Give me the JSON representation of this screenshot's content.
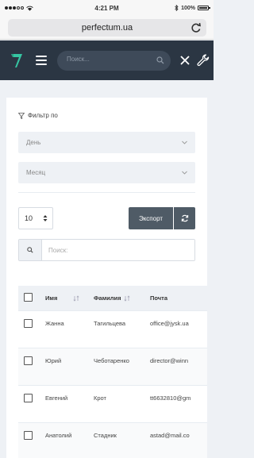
{
  "status_bar": {
    "time": "4:21 PM",
    "battery": "100%"
  },
  "browser": {
    "url": "perfectum.ua"
  },
  "header": {
    "search_placeholder": "Поиск..."
  },
  "filter": {
    "title": "Фильтр по",
    "day_select": "День",
    "month_select": "Месяц"
  },
  "toolbar": {
    "page_size": "10",
    "export_label": "Экспорт",
    "search_placeholder": "Поиск:"
  },
  "table": {
    "columns": [
      "Имя",
      "Фамилия",
      "Почта"
    ],
    "rows": [
      {
        "first_name": "Жанна",
        "last_name": "Тагильцева",
        "email": "office@jysk.ua"
      },
      {
        "first_name": "Юрий",
        "last_name": "Чеботаренко",
        "email": "director@winn"
      },
      {
        "first_name": "Евгений",
        "last_name": "Крот",
        "email": "tt6632810@gm"
      },
      {
        "first_name": "Анатолий",
        "last_name": "Стадник",
        "email": "astad@mail.co"
      }
    ]
  },
  "colors": {
    "header_bg": "#2b3643",
    "page_bg": "#eef1f5",
    "button_bg": "#4f5b66",
    "logo": "#36c6a3"
  },
  "icons": [
    "wifi-icon",
    "bluetooth-icon",
    "battery-icon",
    "reload-icon",
    "logo-icon",
    "menu-icon",
    "search-icon",
    "close-icon",
    "wrench-icon",
    "filter-icon",
    "chevron-down-icon",
    "refresh-icon",
    "sort-icon"
  ]
}
